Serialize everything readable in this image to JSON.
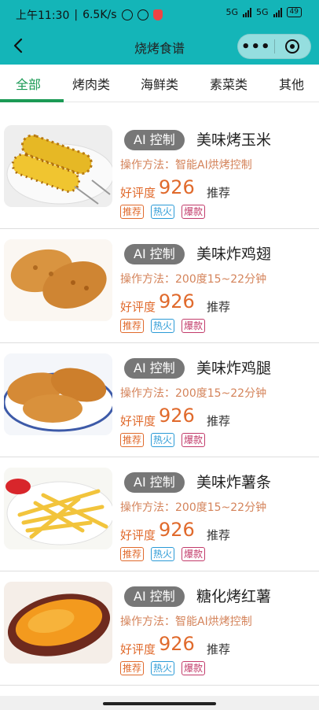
{
  "status_bar": {
    "time": "上午11:30",
    "speed": "6.5K/s",
    "network_label_1": "5G",
    "network_label_2": "5G",
    "battery": "49"
  },
  "nav": {
    "title": "烧烤食谱",
    "more_label": "•••"
  },
  "tabs": [
    {
      "label": "全部"
    },
    {
      "label": "烤肉类"
    },
    {
      "label": "海鲜类"
    },
    {
      "label": "素菜类"
    },
    {
      "label": "其他"
    }
  ],
  "items": [
    {
      "badge": "AI 控制",
      "name": "美味烤玉米",
      "method": "操作方法：智能AI烘烤控制",
      "score_label": "好评度",
      "score": "926",
      "recommend": "推荐",
      "tags": [
        "推荐",
        "热火",
        "爆款"
      ]
    },
    {
      "badge": "AI 控制",
      "name": "美味炸鸡翅",
      "method": "操作方法：200度15~22分钟",
      "score_label": "好评度",
      "score": "926",
      "recommend": "推荐",
      "tags": [
        "推荐",
        "热火",
        "爆款"
      ]
    },
    {
      "badge": "AI 控制",
      "name": "美味炸鸡腿",
      "method": "操作方法：200度15~22分钟",
      "score_label": "好评度",
      "score": "926",
      "recommend": "推荐",
      "tags": [
        "推荐",
        "热火",
        "爆款"
      ]
    },
    {
      "badge": "AI 控制",
      "name": "美味炸薯条",
      "method": "操作方法：200度15~22分钟",
      "score_label": "好评度",
      "score": "926",
      "recommend": "推荐",
      "tags": [
        "推荐",
        "热火",
        "爆款"
      ]
    },
    {
      "badge": "AI 控制",
      "name": "糖化烤红薯",
      "method": "操作方法：智能AI烘烤控制",
      "score_label": "好评度",
      "score": "926",
      "recommend": "推荐",
      "tags": [
        "推荐",
        "热火",
        "爆款"
      ]
    }
  ],
  "colors": {
    "header": "#14b5b8",
    "active_tab": "#1b9a55",
    "accent": "#e06a2c"
  }
}
